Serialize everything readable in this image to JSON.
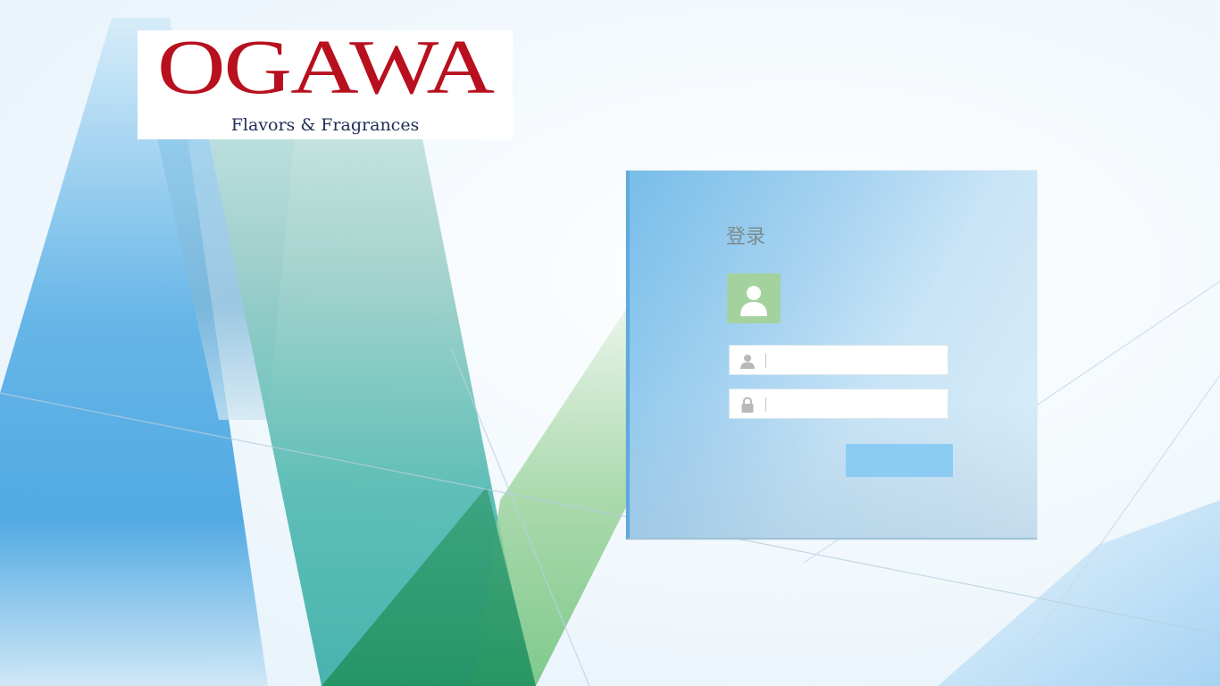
{
  "logo": {
    "wordmark": "OGAWA",
    "tagline": "Flavors & Fragrances",
    "color": "#b8101e"
  },
  "login": {
    "title": "登录",
    "avatar_icon": "user-avatar-icon",
    "username": {
      "icon": "user-icon",
      "value": "",
      "placeholder": ""
    },
    "password": {
      "icon": "lock-icon",
      "value": "",
      "placeholder": ""
    },
    "submit_label": ""
  },
  "colors": {
    "panel_accent": "#78bde9",
    "avatar_bg": "#a3d29f",
    "button_bg": "#8ccbf2"
  }
}
